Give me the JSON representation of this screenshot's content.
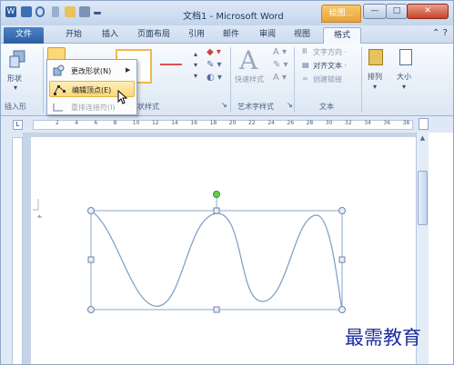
{
  "window": {
    "title": "文档1 - Microsoft Word",
    "context_tab": "绘图...",
    "buttons": {
      "minimize": "—",
      "maximize": "□",
      "close": "✕"
    }
  },
  "tabs": [
    "文件",
    "开始",
    "插入",
    "页面布局",
    "引用",
    "邮件",
    "审阅",
    "视图",
    "格式"
  ],
  "help": "⌃ ?",
  "ribbon": {
    "shape_btn": "形状",
    "insert_group": "插入形",
    "styles_group": "状样式",
    "wordart_btn": "快速样式",
    "wordart_group": "艺术字样式",
    "text_direction": "文字方向 ·",
    "align_text": "对齐文本 ·",
    "create_link": "创建链接",
    "text_group": "文本",
    "arrange": "排列",
    "size": "大小"
  },
  "menu": {
    "change_shape": "更改形状(N)",
    "edit_points": "编辑顶点(E)",
    "reroute": "重排连接符(I)"
  },
  "ruler_numbers": [
    "2",
    "4",
    "6",
    "8",
    "10",
    "12",
    "14",
    "16",
    "18",
    "20",
    "22",
    "24",
    "26",
    "28",
    "30",
    "32",
    "34",
    "36",
    "38"
  ],
  "watermark": "最需教育",
  "colors": {
    "accent": "#2a5ea3",
    "context": "#e8a23a",
    "shape_line": "#8aa7c9"
  }
}
